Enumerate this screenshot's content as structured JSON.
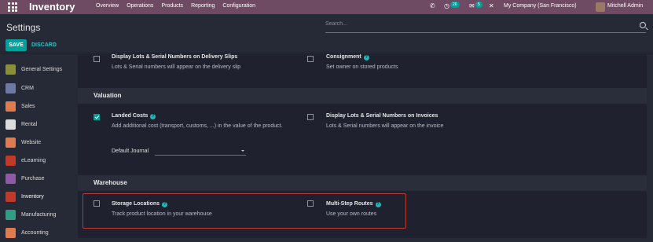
{
  "navbar": {
    "brand": "Inventory",
    "menu": [
      "Overview",
      "Operations",
      "Products",
      "Reporting",
      "Configuration"
    ],
    "messages_badge": "26",
    "activities_badge": "5",
    "company": "My Company (San Francisco)",
    "user": "Mitchell Admin"
  },
  "control": {
    "title": "Settings",
    "search_placeholder": "Search...",
    "save_label": "SAVE",
    "discard_label": "DISCARD"
  },
  "sidebar": {
    "items": [
      {
        "label": "General Settings",
        "icon": "gear-icon",
        "color": "#8a8f3a"
      },
      {
        "label": "CRM",
        "icon": "crm-icon",
        "color": "#6c7aa3"
      },
      {
        "label": "Sales",
        "icon": "sales-icon",
        "color": "#e07a4f"
      },
      {
        "label": "Rental",
        "icon": "rental-icon",
        "color": "#dcdcdc"
      },
      {
        "label": "Website",
        "icon": "website-icon",
        "color": "#e07a4f"
      },
      {
        "label": "eLearning",
        "icon": "elearning-icon",
        "color": "#c0392b"
      },
      {
        "label": "Purchase",
        "icon": "purchase-icon",
        "color": "#8e5aa8"
      },
      {
        "label": "Inventory",
        "icon": "inventory-icon",
        "color": "#c0392b"
      },
      {
        "label": "Manufacturing",
        "icon": "manufacturing-icon",
        "color": "#2f9e84"
      },
      {
        "label": "Accounting",
        "icon": "accounting-icon",
        "color": "#e07a4f"
      }
    ]
  },
  "content": {
    "top_left": {
      "title": "Display Lots & Serial Numbers on Delivery Slips",
      "desc": "Lots & Serial numbers will appear on the delivery slip"
    },
    "top_right": {
      "title": "Consignment",
      "desc": "Set owner on stored products"
    },
    "valuation_head": "Valuation",
    "landed_costs": {
      "title": "Landed Costs",
      "desc": "Add additional cost (transport, customs, ...) in the value of the product.",
      "journal_label": "Default Journal"
    },
    "lots_invoices": {
      "title": "Display Lots & Serial Numbers on Invoices",
      "desc": "Lots & Serial numbers will appear on the invoice"
    },
    "warehouse_head": "Warehouse",
    "storage": {
      "title": "Storage Locations",
      "desc": "Track product location in your warehouse"
    },
    "routes": {
      "title": "Multi-Step Routes",
      "desc": "Use your own routes"
    }
  }
}
